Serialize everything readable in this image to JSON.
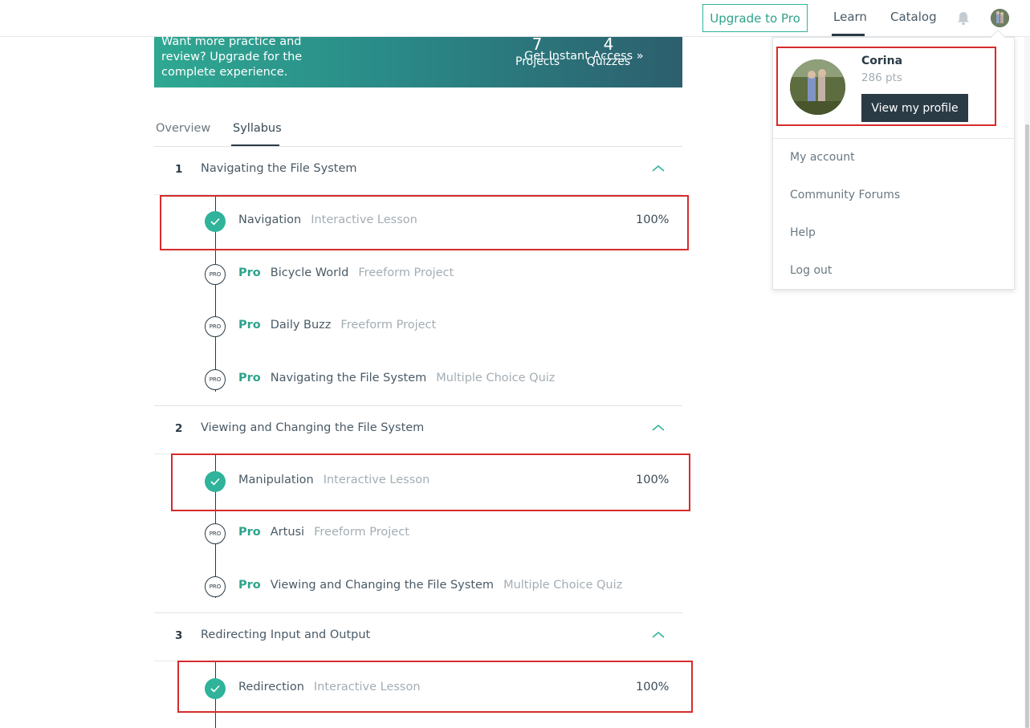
{
  "topbar": {
    "upgrade_label": "Upgrade to Pro",
    "learn_label": "Learn",
    "catalog_label": "Catalog",
    "notifications_icon": "bell-icon"
  },
  "promo": {
    "text": "Want more practice and review? Upgrade for the complete experience.",
    "projects_count": "7",
    "projects_label": "Projects",
    "quizzes_count": "4",
    "quizzes_label": "Quizzes",
    "cta_label": "Get Instant Access »"
  },
  "tabs": {
    "overview": "Overview",
    "syllabus": "Syllabus"
  },
  "syllabus": {
    "sections": [
      {
        "number": "1",
        "title": "Navigating the File System",
        "items": [
          {
            "pro": "",
            "title": "Navigation",
            "type": "Interactive Lesson",
            "progress": "100%",
            "completed": true
          },
          {
            "pro": "Pro",
            "title": "Bicycle World",
            "type": "Freeform Project",
            "progress": "",
            "completed": false
          },
          {
            "pro": "Pro",
            "title": "Daily Buzz",
            "type": "Freeform Project",
            "progress": "",
            "completed": false
          },
          {
            "pro": "Pro",
            "title": "Navigating the File System",
            "type": "Multiple Choice Quiz",
            "progress": "",
            "completed": false
          }
        ]
      },
      {
        "number": "2",
        "title": "Viewing and Changing the File System",
        "items": [
          {
            "pro": "",
            "title": "Manipulation",
            "type": "Interactive Lesson",
            "progress": "100%",
            "completed": true
          },
          {
            "pro": "Pro",
            "title": "Artusi",
            "type": "Freeform Project",
            "progress": "",
            "completed": false
          },
          {
            "pro": "Pro",
            "title": "Viewing and Changing the File System",
            "type": "Multiple Choice Quiz",
            "progress": "",
            "completed": false
          }
        ]
      },
      {
        "number": "3",
        "title": "Redirecting Input and Output",
        "items": [
          {
            "pro": "",
            "title": "Redirection",
            "type": "Interactive Lesson",
            "progress": "100%",
            "completed": true
          }
        ]
      }
    ],
    "pro_badge_text": "PRO"
  },
  "profile_menu": {
    "name": "Corina",
    "points": "286 pts",
    "view_profile_label": "View my profile",
    "items": [
      "My account",
      "Community Forums",
      "Help",
      "Log out"
    ]
  },
  "colors": {
    "accent": "#2fb39a",
    "dark": "#2b3b46",
    "highlight_box": "#d62b2b"
  }
}
